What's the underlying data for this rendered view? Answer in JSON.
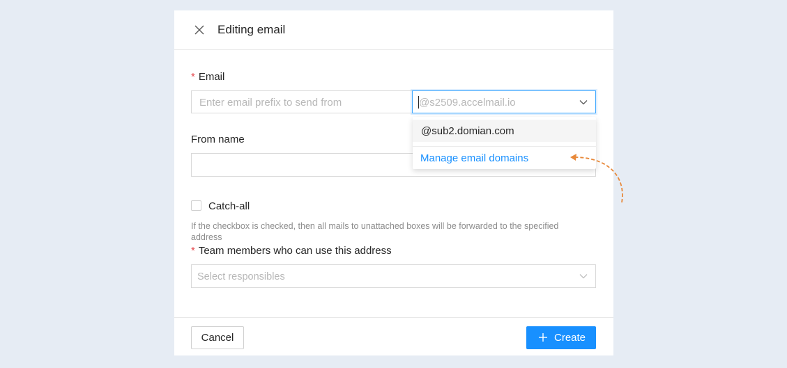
{
  "header": {
    "title": "Editing email",
    "close_icon": "close-icon"
  },
  "email": {
    "label": "Email",
    "required_mark": "*",
    "prefix_placeholder": "Enter email prefix to send from",
    "domain_placeholder": "@s2509.accelmail.io"
  },
  "from_name": {
    "label": "From name",
    "value": ""
  },
  "catch_all": {
    "label": "Catch-all",
    "checked": false,
    "hint": "If the checkbox is checked, then all mails to unattached boxes will be forwarded to the specified address"
  },
  "team": {
    "label": "Team members who can use this address",
    "required_mark": "*",
    "placeholder": "Select responsibles"
  },
  "footer": {
    "cancel_label": "Cancel",
    "create_label": "Create"
  },
  "dropdown": {
    "options": [
      "@sub2.domian.com"
    ],
    "manage_link": "Manage email domains"
  },
  "colors": {
    "accent": "#1890ff",
    "required": "#e5484d",
    "annotation_arrow": "#e8893a"
  }
}
